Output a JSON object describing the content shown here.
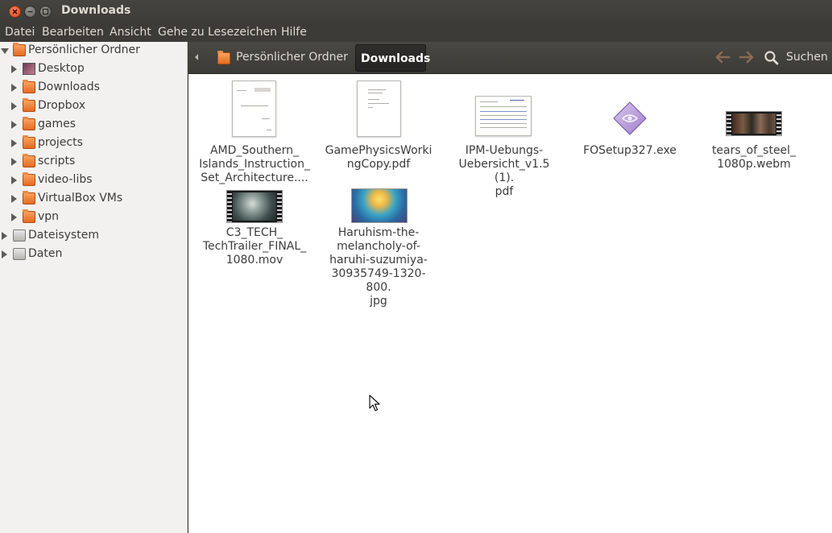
{
  "window": {
    "title": "Downloads"
  },
  "menu": [
    "Datei",
    "Bearbeiten",
    "Ansicht",
    "Gehe zu",
    "Lesezeichen",
    "Hilfe"
  ],
  "sidebar": {
    "root": "Persönlicher Ordner",
    "items": [
      "Desktop",
      "Downloads",
      "Dropbox",
      "games",
      "projects",
      "scripts",
      "video-libs",
      "VirtualBox VMs",
      "vpn"
    ],
    "devices": [
      "Dateisystem",
      "Daten"
    ]
  },
  "pathbar": {
    "home": "Persönlicher Ordner",
    "current": "Downloads"
  },
  "toolbar": {
    "search": "Suchen"
  },
  "files": [
    {
      "name": "AMD_Southern_\nIslands_Instruction_\nSet_Architecture....",
      "kind": "pdf"
    },
    {
      "name": "GamePhysicsWorki\nngCopy.pdf",
      "kind": "pdf"
    },
    {
      "name": "IPM-Uebungs-\nUebersicht_v1.5 (1).\npdf",
      "kind": "pdf"
    },
    {
      "name": "FOSetup327.exe",
      "kind": "exe"
    },
    {
      "name": "tears_of_steel_\n1080p.webm",
      "kind": "video"
    },
    {
      "name": "C3_TECH_\nTechTrailer_FINAL_\n1080.mov",
      "kind": "video"
    },
    {
      "name": "Haruhism-the-\nmelancholy-of-\nharuhi-suzumiya-\n30935749-1320-800.\njpg",
      "kind": "image"
    }
  ],
  "colors": {
    "accent": "#dd4814",
    "chrome": "#3c3b37",
    "sidebar_bg": "#f2f1f0",
    "folder": "#e46b25"
  }
}
